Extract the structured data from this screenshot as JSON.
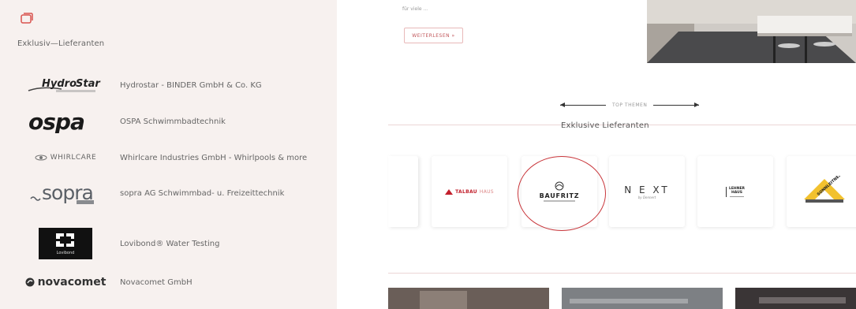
{
  "left": {
    "title": "Exklusiv—Lieferanten",
    "suppliers": [
      {
        "logo_text": "HydroStar",
        "name": "Hydrostar - BINDER GmbH & Co. KG"
      },
      {
        "logo_text": "ospa",
        "name": "OSPA Schwimmbadtechnik"
      },
      {
        "logo_text": "WHIRLCARE",
        "name": "Whirlcare Industries GmbH - Whirlpools & more"
      },
      {
        "logo_text": "sopra",
        "name": "sopra AG Schwimmbad- u. Freizeittechnik"
      },
      {
        "logo_text": "Lovibond",
        "name": "Lovibond® Water Testing"
      },
      {
        "logo_text": "novacomet",
        "name": "Novacomet GmbH"
      }
    ]
  },
  "right": {
    "top_text": "für viele ...",
    "readmore_label": "WEITERLESEN »",
    "topthemen_label": "TOP THEMEN",
    "section_title": "Exklusive Lieferanten",
    "cards": [
      {
        "logo_text": "TALBAU",
        "logo_sub": "HAUS"
      },
      {
        "logo_text": "BAUFRITZ"
      },
      {
        "logo_text": "N E XT",
        "logo_sub": "by Dennert"
      },
      {
        "logo_text": "LEHNER",
        "logo_sub": "HAUS"
      },
      {
        "logo_text": "SONNLEITNER"
      }
    ]
  },
  "colors": {
    "left_bg": "#f7f1ef",
    "accent_red": "#c8353a",
    "divider_pink": "#ecd6d6"
  }
}
